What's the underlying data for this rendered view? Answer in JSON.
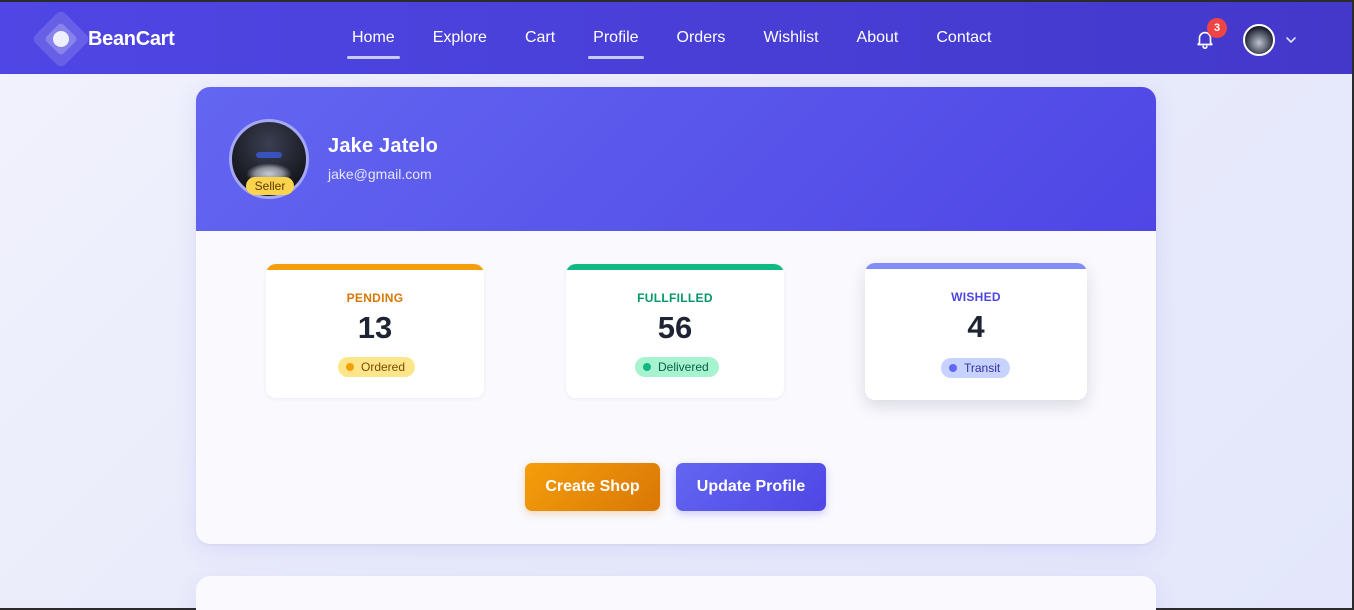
{
  "brand": {
    "name": "BeanCart"
  },
  "nav": {
    "links": [
      {
        "label": "Home",
        "active": true
      },
      {
        "label": "Explore",
        "active": false
      },
      {
        "label": "Cart",
        "active": false
      },
      {
        "label": "Profile",
        "active": true
      },
      {
        "label": "Orders",
        "active": false
      },
      {
        "label": "Wishlist",
        "active": false
      },
      {
        "label": "About",
        "active": false
      },
      {
        "label": "Contact",
        "active": false
      }
    ],
    "notification_count": "3",
    "icons": [
      "bell-icon",
      "chevron-down-icon"
    ]
  },
  "profile": {
    "name": "Jake Jatelo",
    "email": "jake@gmail.com",
    "role_tag": "Seller"
  },
  "stats": [
    {
      "label": "PENDING",
      "value": "13",
      "status": "Ordered",
      "accent": "#f59e0b"
    },
    {
      "label": "FULLFILLED",
      "value": "56",
      "status": "Delivered",
      "accent": "#10b981"
    },
    {
      "label": "WISHED",
      "value": "4",
      "status": "Transit",
      "accent": "#6366f1"
    }
  ],
  "actions": {
    "create_shop": "Create Shop",
    "update_profile": "Update Profile"
  },
  "colors": {
    "primary": "#4f46e5",
    "warning": "#f59e0b",
    "success": "#10b981",
    "danger": "#ef4444"
  }
}
